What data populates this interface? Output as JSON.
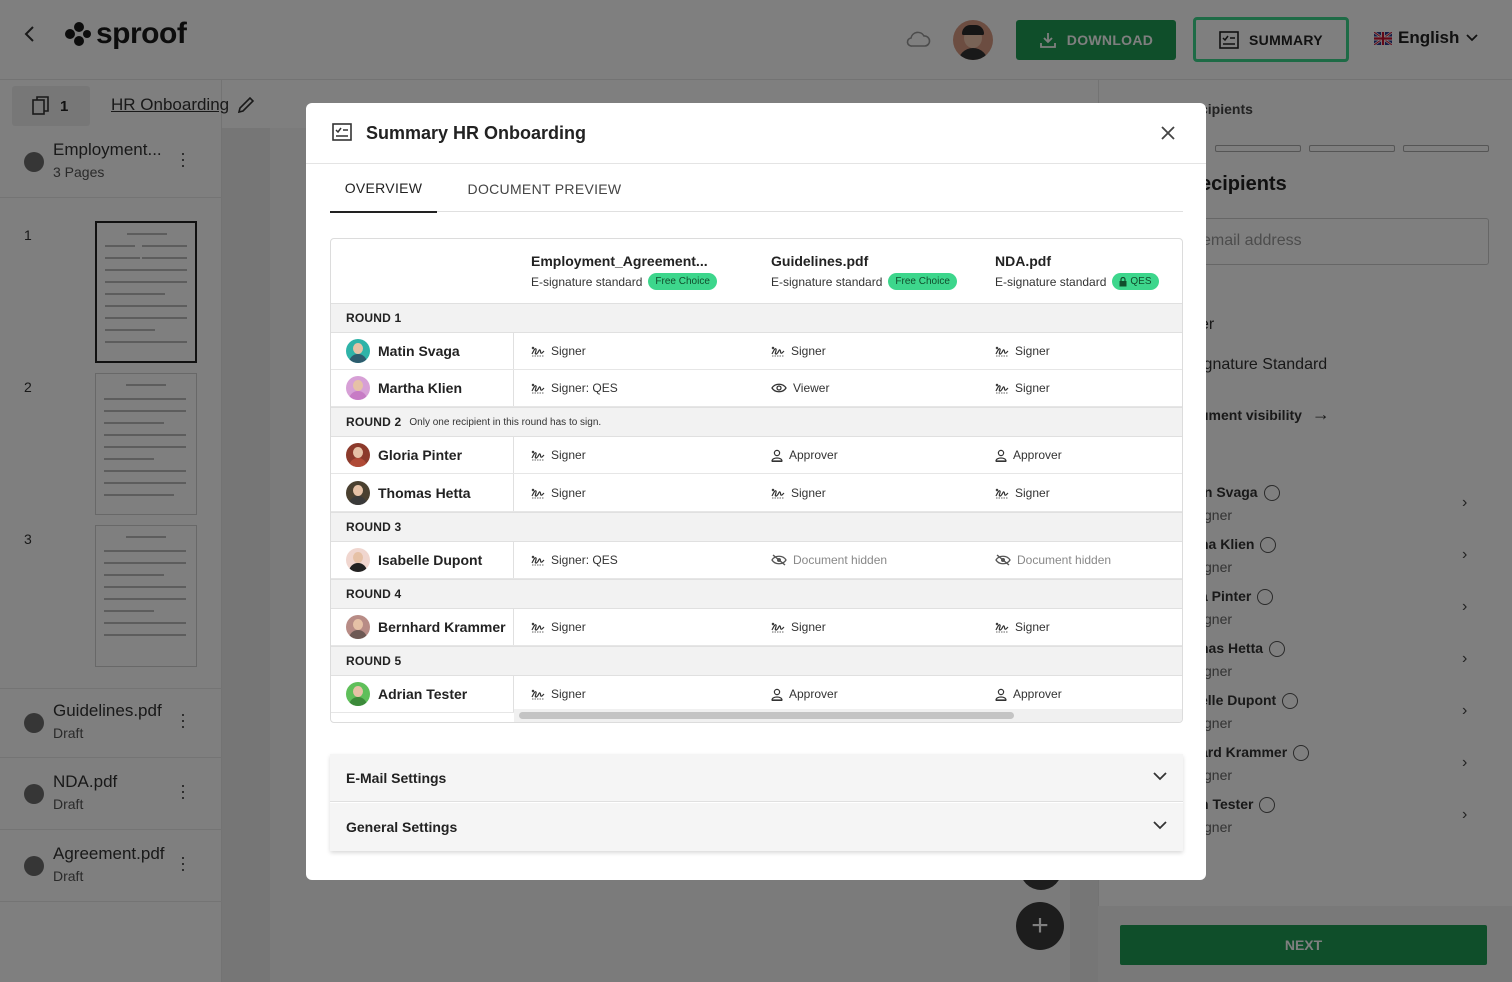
{
  "app": {
    "logo_text": "sproof",
    "download_label": "DOWNLOAD",
    "summary_label": "SUMMARY",
    "language": "English",
    "page_count": "1",
    "document_title": "HR Onboarding",
    "next_label": "NEXT",
    "accent_color": "#1f9d55",
    "highlight_color": "#3dd68c"
  },
  "sidebar": {
    "documents": [
      {
        "name": "Employment...",
        "sub": "3 Pages"
      },
      {
        "name": "Guidelines.pdf",
        "sub": "Draft"
      },
      {
        "name": "NDA.pdf",
        "sub": "Draft"
      },
      {
        "name": "Agreement.pdf",
        "sub": "Draft"
      }
    ],
    "thumbnails": [
      "1",
      "2",
      "3"
    ]
  },
  "right_panel": {
    "step_label": "cipients",
    "heading": "ecipients",
    "email_placeholder": "email address",
    "role_label": "er",
    "standard_label": "ignature Standard",
    "visibility_label": "ument visibility",
    "recipients": [
      {
        "name": "in Svaga",
        "role": "gner"
      },
      {
        "name": "ha Klien",
        "role": "gner"
      },
      {
        "name": "a Pinter",
        "role": "gner"
      },
      {
        "name": "nas Hetta",
        "role": "gner"
      },
      {
        "name": "elle Dupont",
        "role": "gner"
      },
      {
        "name": "ard Krammer",
        "role": "gner"
      },
      {
        "name": "n Tester",
        "role": "gner"
      }
    ]
  },
  "modal": {
    "title": "Summary HR Onboarding",
    "tabs": [
      {
        "label": "OVERVIEW",
        "active": true
      },
      {
        "label": "DOCUMENT PREVIEW",
        "active": false
      }
    ],
    "columns": [
      {
        "file": "Employment_Agreement...",
        "standard": "E-signature standard",
        "badge": "Free Choice"
      },
      {
        "file": "Guidelines.pdf",
        "standard": "E-signature standard",
        "badge": "Free Choice"
      },
      {
        "file": "NDA.pdf",
        "standard": "E-signature standard",
        "badge": "QES"
      }
    ],
    "rounds": [
      {
        "label": "ROUND 1",
        "note": "",
        "participants": [
          {
            "name": "Matin Svaga",
            "roles": [
              "Signer",
              "Signer",
              "Signer"
            ],
            "icons": [
              "sign",
              "sign",
              "sign"
            ]
          },
          {
            "name": "Martha Klien",
            "roles": [
              "Signer: QES",
              "Viewer",
              "Signer"
            ],
            "icons": [
              "sign",
              "eye",
              "sign"
            ]
          }
        ]
      },
      {
        "label": "ROUND 2",
        "note": "Only one recipient in this round has to sign.",
        "participants": [
          {
            "name": "Gloria Pinter",
            "roles": [
              "Signer",
              "Approver",
              "Approver"
            ],
            "icons": [
              "sign",
              "person",
              "person"
            ]
          },
          {
            "name": "Thomas Hetta",
            "roles": [
              "Signer",
              "Signer",
              "Signer"
            ],
            "icons": [
              "sign",
              "sign",
              "sign"
            ]
          }
        ]
      },
      {
        "label": "ROUND 3",
        "note": "",
        "participants": [
          {
            "name": "Isabelle Dupont",
            "roles": [
              "Signer: QES",
              "Document hidden",
              "Document hidden"
            ],
            "icons": [
              "sign",
              "eye-off",
              "eye-off"
            ]
          }
        ]
      },
      {
        "label": "ROUND 4",
        "note": "",
        "participants": [
          {
            "name": "Bernhard Krammer",
            "roles": [
              "Signer",
              "Signer",
              "Signer"
            ],
            "icons": [
              "sign",
              "sign",
              "sign"
            ]
          }
        ]
      },
      {
        "label": "ROUND 5",
        "note": "",
        "participants": [
          {
            "name": "Adrian Tester",
            "roles": [
              "Signer",
              "Approver",
              "Approver"
            ],
            "icons": [
              "sign",
              "person",
              "person"
            ]
          }
        ]
      }
    ],
    "email_settings_label": "E-Mail Settings",
    "general_settings_label": "General Settings"
  }
}
